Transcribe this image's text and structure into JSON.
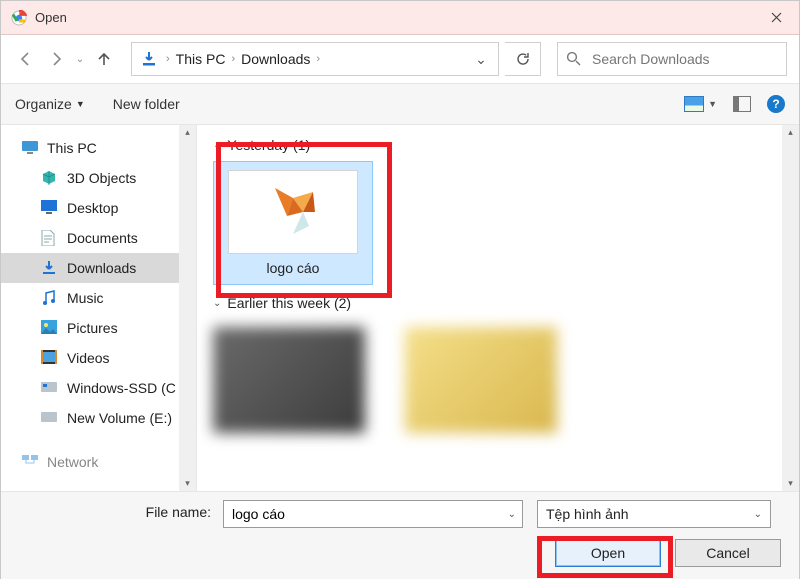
{
  "titlebar": {
    "title": "Open"
  },
  "nav": {
    "crumbs": [
      "This PC",
      "Downloads"
    ],
    "search_placeholder": "Search Downloads"
  },
  "toolbar": {
    "organize": "Organize",
    "new_folder": "New folder"
  },
  "sidebar": {
    "items": [
      {
        "label": "This PC",
        "icon": "monitor",
        "level": 0
      },
      {
        "label": "3D Objects",
        "icon": "cube",
        "level": 1
      },
      {
        "label": "Desktop",
        "icon": "desktop",
        "level": 1
      },
      {
        "label": "Documents",
        "icon": "doc",
        "level": 1
      },
      {
        "label": "Downloads",
        "icon": "download",
        "level": 1,
        "selected": true
      },
      {
        "label": "Music",
        "icon": "music",
        "level": 1
      },
      {
        "label": "Pictures",
        "icon": "picture",
        "level": 1
      },
      {
        "label": "Videos",
        "icon": "video",
        "level": 1
      },
      {
        "label": "Windows-SSD (C",
        "icon": "drive",
        "level": 1
      },
      {
        "label": "New Volume (E:)",
        "icon": "drive",
        "level": 1
      },
      {
        "label": "Network",
        "icon": "network",
        "level": 0,
        "dim": true
      }
    ]
  },
  "content": {
    "groups": [
      {
        "header": "Yesterday (1)",
        "items": [
          {
            "label": "logo cáo",
            "selected": true,
            "preview": "fox"
          }
        ]
      },
      {
        "header": "Earlier this week (2)",
        "items": [
          {
            "label": "",
            "preview": "blur-dark"
          },
          {
            "label": "",
            "preview": "blur-folder"
          }
        ]
      }
    ]
  },
  "footer": {
    "filename_label": "File name:",
    "filename_value": "logo cáo",
    "filetype_value": "Tệp hình ảnh",
    "open": "Open",
    "cancel": "Cancel"
  }
}
